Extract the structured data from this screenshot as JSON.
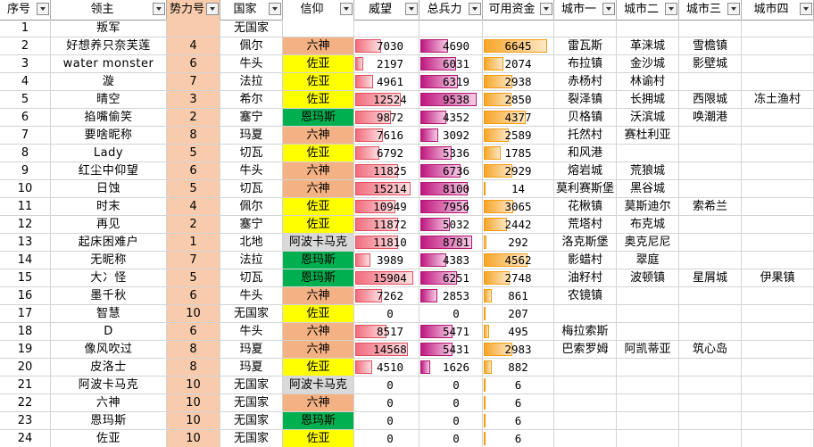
{
  "headers": {
    "id": "序号",
    "lord": "领主",
    "power": "势力号",
    "nation": "国家",
    "faith": "信仰",
    "prestige": "威望",
    "troops": "总兵力",
    "funds": "可用资金",
    "city1": "城市一",
    "city2": "城市二",
    "city3": "城市三",
    "city4": "城市四"
  },
  "faith_colors": {
    "六神": "#f4b183",
    "佐亚": "#ffff00",
    "恩玛斯": "#00b050",
    "阿波卡马克": "#d9d9d9"
  },
  "bar_maxima": {
    "prestige": 15904,
    "troops": 9538,
    "funds": 6645
  },
  "rows": [
    {
      "id": "1",
      "lord": "叛军",
      "power": "",
      "nation": "无国家",
      "faith": "",
      "prestige": "",
      "troops": "",
      "funds": "",
      "cities": [
        "",
        "",
        "",
        ""
      ]
    },
    {
      "id": "2",
      "lord": "好想养只奈芙莲",
      "power": "4",
      "nation": "佩尔",
      "faith": "六神",
      "prestige": "7030",
      "troops": "4690",
      "funds": "6645",
      "cities": [
        "雷瓦斯",
        "革涞城",
        "雪檐镇",
        ""
      ]
    },
    {
      "id": "3",
      "lord": "water monster",
      "power": "6",
      "nation": "牛头",
      "faith": "佐亚",
      "prestige": "2197",
      "troops": "6031",
      "funds": "2074",
      "cities": [
        "布拉镇",
        "金沙城",
        "影壁城",
        ""
      ]
    },
    {
      "id": "4",
      "lord": "漩",
      "power": "7",
      "nation": "法拉",
      "faith": "佐亚",
      "prestige": "4961",
      "troops": "6319",
      "funds": "2938",
      "cities": [
        "赤杨村",
        "林谕村",
        "",
        ""
      ]
    },
    {
      "id": "5",
      "lord": "晴空",
      "power": "3",
      "nation": "希尔",
      "faith": "佐亚",
      "prestige": "12524",
      "troops": "9538",
      "funds": "2850",
      "cities": [
        "裂泽镇",
        "长拥城",
        "西限城",
        "冻土渔村"
      ]
    },
    {
      "id": "6",
      "lord": "掐嘴偷笑",
      "power": "2",
      "nation": "塞宁",
      "faith": "恩玛斯",
      "prestige": "9872",
      "troops": "4352",
      "funds": "4377",
      "cities": [
        "贝格镇",
        "沃滨城",
        "唤潮港",
        ""
      ]
    },
    {
      "id": "7",
      "lord": "要啥昵称",
      "power": "8",
      "nation": "玛夏",
      "faith": "六神",
      "prestige": "7616",
      "troops": "3092",
      "funds": "2589",
      "cities": [
        "托然村",
        "赛杜利亚",
        "",
        ""
      ]
    },
    {
      "id": "8",
      "lord": "Lady",
      "power": "5",
      "nation": "切瓦",
      "faith": "佐亚",
      "prestige": "6792",
      "troops": "5336",
      "funds": "1785",
      "cities": [
        "和风港",
        "",
        "",
        ""
      ]
    },
    {
      "id": "9",
      "lord": "红尘中仰望",
      "power": "6",
      "nation": "牛头",
      "faith": "六神",
      "prestige": "11825",
      "troops": "6736",
      "funds": "2929",
      "cities": [
        "熔岩城",
        "荒狼城",
        "",
        ""
      ]
    },
    {
      "id": "10",
      "lord": "日蚀",
      "power": "5",
      "nation": "切瓦",
      "faith": "六神",
      "prestige": "15214",
      "troops": "8100",
      "funds": "14",
      "cities": [
        "莫利赛斯堡",
        "黑谷城",
        "",
        ""
      ]
    },
    {
      "id": "11",
      "lord": "时末",
      "power": "4",
      "nation": "佩尔",
      "faith": "佐亚",
      "prestige": "10949",
      "troops": "7956",
      "funds": "3065",
      "cities": [
        "花楸镇",
        "莫斯迪尔",
        "索希兰",
        ""
      ]
    },
    {
      "id": "12",
      "lord": "再见",
      "power": "2",
      "nation": "塞宁",
      "faith": "佐亚",
      "prestige": "11872",
      "troops": "5032",
      "funds": "2442",
      "cities": [
        "荒塔村",
        "布克城",
        "",
        ""
      ]
    },
    {
      "id": "13",
      "lord": "起床困难户",
      "power": "1",
      "nation": "北地",
      "faith": "阿波卡马克",
      "prestige": "11810",
      "troops": "8781",
      "funds": "292",
      "cities": [
        "洛克斯堡",
        "奥克尼尼",
        "",
        ""
      ]
    },
    {
      "id": "14",
      "lord": "无昵称",
      "power": "7",
      "nation": "法拉",
      "faith": "恩玛斯",
      "prestige": "3989",
      "troops": "4383",
      "funds": "4562",
      "cities": [
        "影蜡村",
        "翠庭",
        "",
        ""
      ]
    },
    {
      "id": "15",
      "lord": "大冫怪",
      "power": "5",
      "nation": "切瓦",
      "faith": "恩玛斯",
      "prestige": "15904",
      "troops": "6251",
      "funds": "2748",
      "cities": [
        "油籽村",
        "波顿镇",
        "星屑城",
        "伊果镇"
      ]
    },
    {
      "id": "16",
      "lord": "墨千秋",
      "power": "6",
      "nation": "牛头",
      "faith": "六神",
      "prestige": "7262",
      "troops": "2853",
      "funds": "861",
      "cities": [
        "农镜镇",
        "",
        "",
        ""
      ]
    },
    {
      "id": "17",
      "lord": "智慧",
      "power": "10",
      "nation": "无国家",
      "faith": "佐亚",
      "prestige": "0",
      "troops": "0",
      "funds": "207",
      "cities": [
        "",
        "",
        "",
        ""
      ]
    },
    {
      "id": "18",
      "lord": "D",
      "power": "6",
      "nation": "牛头",
      "faith": "六神",
      "prestige": "8517",
      "troops": "5471",
      "funds": "495",
      "cities": [
        "梅拉索斯",
        "",
        "",
        ""
      ]
    },
    {
      "id": "19",
      "lord": "像风吹过",
      "power": "8",
      "nation": "玛夏",
      "faith": "六神",
      "prestige": "14568",
      "troops": "5431",
      "funds": "2983",
      "cities": [
        "巴索罗姆",
        "阿凯蒂亚",
        "筑心岛",
        ""
      ]
    },
    {
      "id": "20",
      "lord": "皮洛士",
      "power": "8",
      "nation": "玛夏",
      "faith": "佐亚",
      "prestige": "4510",
      "troops": "1626",
      "funds": "882",
      "cities": [
        "",
        "",
        "",
        ""
      ]
    },
    {
      "id": "21",
      "lord": "阿波卡马克",
      "power": "10",
      "nation": "无国家",
      "faith": "阿波卡马克",
      "prestige": "0",
      "troops": "0",
      "funds": "6",
      "cities": [
        "",
        "",
        "",
        ""
      ]
    },
    {
      "id": "22",
      "lord": "六神",
      "power": "10",
      "nation": "无国家",
      "faith": "六神",
      "prestige": "0",
      "troops": "0",
      "funds": "6",
      "cities": [
        "",
        "",
        "",
        ""
      ]
    },
    {
      "id": "23",
      "lord": "恩玛斯",
      "power": "10",
      "nation": "无国家",
      "faith": "恩玛斯",
      "prestige": "0",
      "troops": "0",
      "funds": "6",
      "cities": [
        "",
        "",
        "",
        ""
      ]
    },
    {
      "id": "24",
      "lord": "佐亚",
      "power": "10",
      "nation": "无国家",
      "faith": "佐亚",
      "prestige": "0",
      "troops": "0",
      "funds": "6",
      "cities": [
        "",
        "",
        "",
        ""
      ]
    }
  ]
}
